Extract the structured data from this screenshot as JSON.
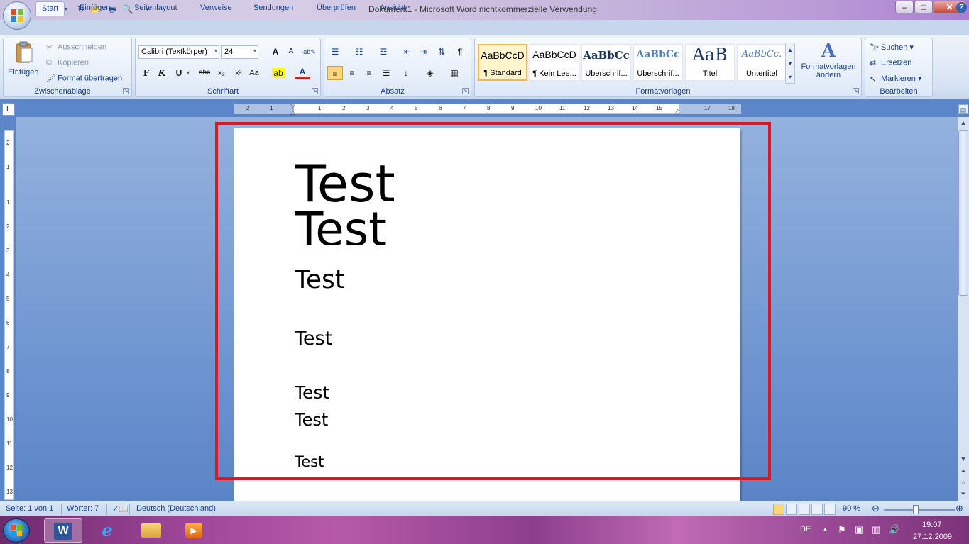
{
  "window": {
    "title": "Dokument1 - Microsoft Word nichtkommerzielle Verwendung",
    "minimize": "–",
    "maximize": "□",
    "close": "✕"
  },
  "tabs": [
    "Start",
    "Einfügen",
    "Seitenlayout",
    "Verweise",
    "Sendungen",
    "Überprüfen",
    "Ansicht"
  ],
  "clipboard": {
    "paste_label": "Einfügen",
    "cut_label": "Ausschneiden",
    "copy_label": "Kopieren",
    "format_painter_label": "Format übertragen",
    "group_label": "Zwischenablage"
  },
  "font": {
    "family": "Calibri (Textkörper)",
    "size": "24",
    "group_label": "Schriftart",
    "bold": "F",
    "italic": "K",
    "underline": "U",
    "strike": "abc",
    "subscript": "x₂",
    "superscript": "x²",
    "change_case": "Aa",
    "grow": "A",
    "shrink": "A"
  },
  "paragraph": {
    "group_label": "Absatz",
    "pilcrow": "¶"
  },
  "styles": {
    "group_label": "Formatvorlagen",
    "items": [
      {
        "sample": "AaBbCcD",
        "name": "¶ Standard"
      },
      {
        "sample": "AaBbCcD",
        "name": "¶ Kein Lee..."
      },
      {
        "sample": "AaBbCc",
        "name": "Überschrif..."
      },
      {
        "sample": "AaBbCc",
        "name": "Überschrif..."
      },
      {
        "sample": "AaB",
        "name": "Titel"
      },
      {
        "sample": "AaBbCc.",
        "name": "Untertitel"
      }
    ],
    "change_styles_line1": "Formatvorlagen",
    "change_styles_line2": "ändern"
  },
  "editing": {
    "find_label": "Suchen",
    "replace_label": "Ersetzen",
    "select_label": "Markieren",
    "group_label": "Bearbeiten"
  },
  "ruler": {
    "corner": "L",
    "h_ticks": [
      "2",
      "1",
      "1",
      "2",
      "3",
      "4",
      "5",
      "6",
      "7",
      "8",
      "9",
      "10",
      "11",
      "12",
      "13",
      "14",
      "15",
      "17",
      "18"
    ],
    "v_ticks": [
      "2",
      "1",
      "1",
      "2",
      "3",
      "4",
      "5",
      "6",
      "7",
      "8",
      "9",
      "10",
      "11",
      "12",
      "13"
    ]
  },
  "document": {
    "lines": [
      {
        "text": "Test"
      },
      {
        "text": "Test"
      },
      {
        "text": "Test"
      },
      {
        "text": "Test"
      },
      {
        "text": "Test"
      },
      {
        "text": "Test"
      },
      {
        "text": "Test"
      }
    ]
  },
  "status": {
    "page": "Seite: 1 von 1",
    "words": "Wörter: 7",
    "language": "Deutsch (Deutschland)",
    "zoom": "90 %",
    "zoom_fraction": 0.45
  },
  "taskbar": {
    "language": "DE",
    "time": "19:07",
    "date": "27.12.2009"
  },
  "colors": {
    "highlight_border": "#e8131c",
    "accent": "#15428b"
  }
}
